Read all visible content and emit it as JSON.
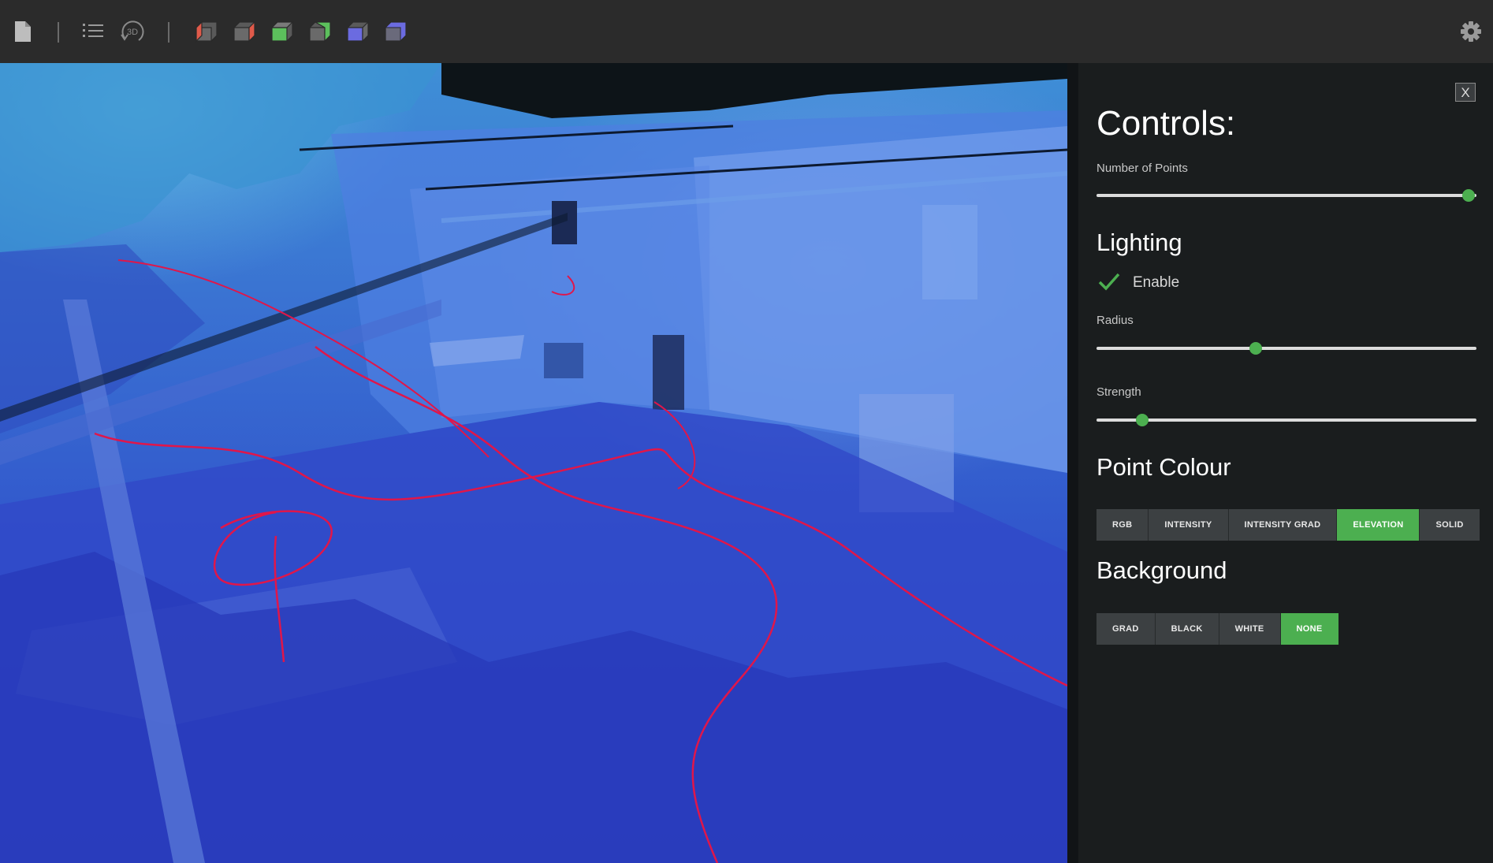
{
  "toolbar": {
    "tools": [
      {
        "name": "file-icon"
      },
      {
        "name": "list-icon"
      },
      {
        "name": "rotate-3d-icon",
        "label": "3D"
      },
      {
        "name": "cube-view-left-icon",
        "face_color": "#e05a4a"
      },
      {
        "name": "cube-view-right-icon",
        "face_color": "#e05a4a"
      },
      {
        "name": "cube-view-top-icon",
        "face_color": "#5cc05c"
      },
      {
        "name": "cube-view-bottom-icon",
        "face_color": "#5cc05c"
      },
      {
        "name": "cube-view-front-icon",
        "face_color": "#6b6be0"
      },
      {
        "name": "cube-view-back-icon",
        "face_color": "#6b6be0"
      },
      {
        "name": "settings-gear-icon"
      }
    ]
  },
  "controls": {
    "title": "Controls:",
    "close_label": "X",
    "number_of_points": {
      "label": "Number of Points",
      "value_fraction": 0.98
    },
    "lighting": {
      "title": "Lighting",
      "enable": {
        "label": "Enable",
        "checked": true
      },
      "radius": {
        "label": "Radius",
        "value_fraction": 0.42
      },
      "strength": {
        "label": "Strength",
        "value_fraction": 0.12
      }
    },
    "point_colour": {
      "title": "Point Colour",
      "options": [
        "RGB",
        "INTENSITY",
        "INTENSITY GRAD",
        "ELEVATION",
        "SOLID"
      ],
      "selected": "ELEVATION"
    },
    "background": {
      "title": "Background",
      "options": [
        "GRAD",
        "BLACK",
        "WHITE",
        "NONE"
      ],
      "selected": "NONE"
    }
  },
  "colors": {
    "accent": "#4caf50",
    "trajectory": "#e0164a",
    "toolbar_bg": "#2b2b2b",
    "panel_bg": "#1a1d1e"
  }
}
